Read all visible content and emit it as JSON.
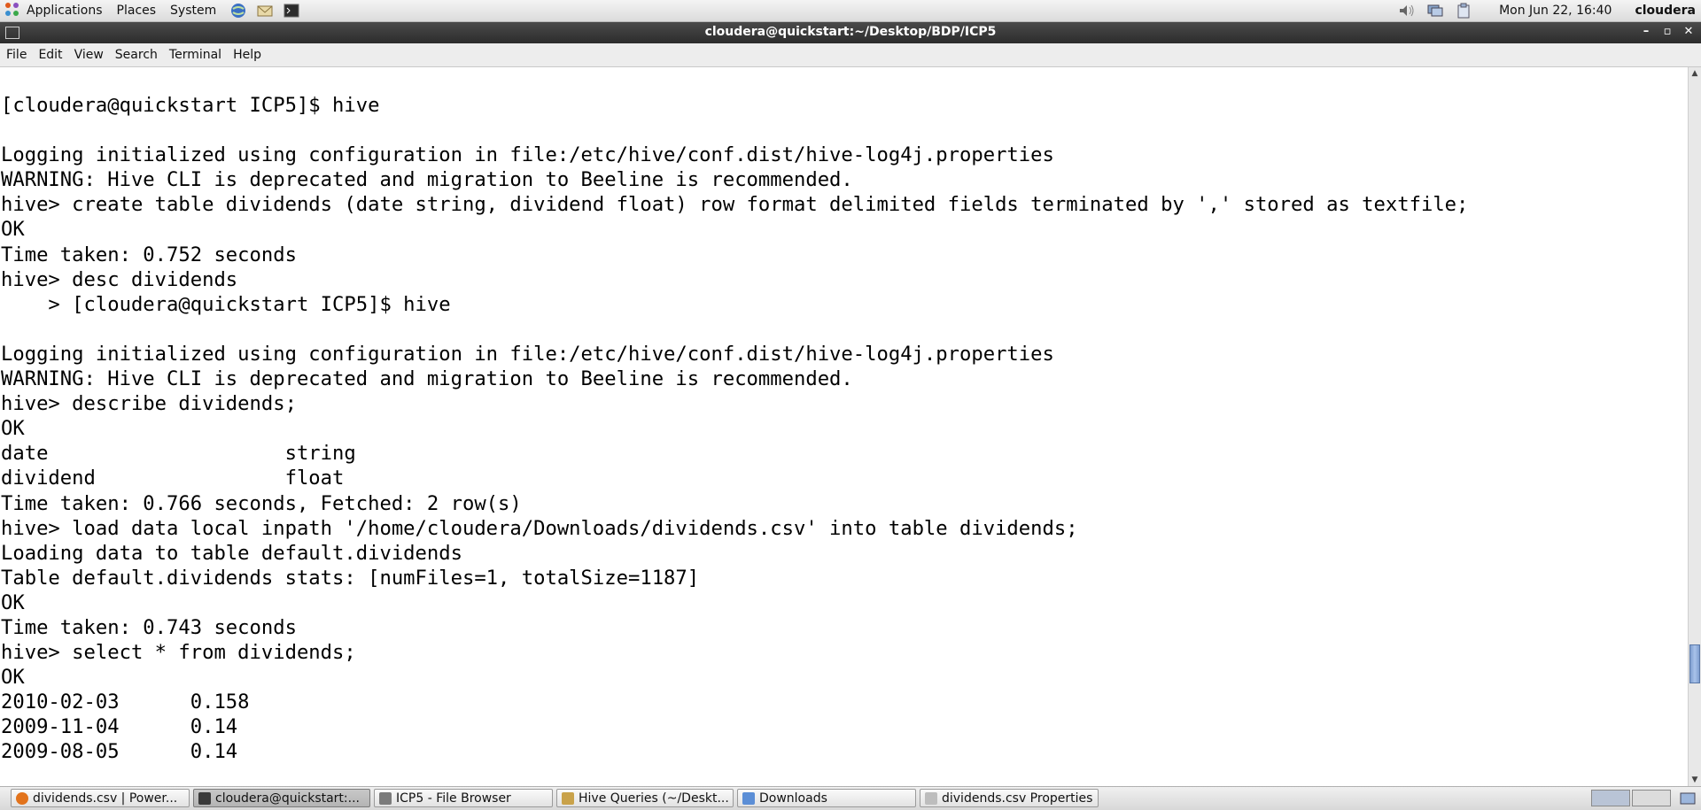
{
  "top_panel": {
    "menus": [
      "Applications",
      "Places",
      "System"
    ],
    "datetime": "Mon Jun 22, 16:40",
    "user": "cloudera"
  },
  "window": {
    "title": "cloudera@quickstart:~/Desktop/BDP/ICP5",
    "controls": [
      "–",
      "▫",
      "✕"
    ]
  },
  "menubar": [
    "File",
    "Edit",
    "View",
    "Search",
    "Terminal",
    "Help"
  ],
  "terminal": {
    "lines": [
      "[cloudera@quickstart ICP5]$ hive",
      "",
      "Logging initialized using configuration in file:/etc/hive/conf.dist/hive-log4j.properties",
      "WARNING: Hive CLI is deprecated and migration to Beeline is recommended.",
      "hive> create table dividends (date string, dividend float) row format delimited fields terminated by ',' stored as textfile;",
      "OK",
      "Time taken: 0.752 seconds",
      "hive> desc dividends",
      "    > [cloudera@quickstart ICP5]$ hive",
      "",
      "Logging initialized using configuration in file:/etc/hive/conf.dist/hive-log4j.properties",
      "WARNING: Hive CLI is deprecated and migration to Beeline is recommended.",
      "hive> describe dividends;",
      "OK",
      "date                    string",
      "dividend                float",
      "Time taken: 0.766 seconds, Fetched: 2 row(s)",
      "hive> load data local inpath '/home/cloudera/Downloads/dividends.csv' into table dividends;",
      "Loading data to table default.dividends",
      "Table default.dividends stats: [numFiles=1, totalSize=1187]",
      "OK",
      "Time taken: 0.743 seconds",
      "hive> select * from dividends;",
      "OK",
      "2010-02-03      0.158",
      "2009-11-04      0.14",
      "2009-08-05      0.14"
    ]
  },
  "taskbar": {
    "tasks": [
      {
        "label": "dividends.csv | Power...",
        "icon": "firefox-icon",
        "color": "#e2731c",
        "active": false
      },
      {
        "label": "cloudera@quickstart:...",
        "icon": "terminal-icon",
        "color": "#3a3a3a",
        "active": true
      },
      {
        "label": "ICP5 - File Browser",
        "icon": "file-browser-icon",
        "color": "#7b7b7b",
        "active": false
      },
      {
        "label": "Hive Queries (~/Deskt...",
        "icon": "text-editor-icon",
        "color": "#c9a24a",
        "active": false
      },
      {
        "label": "Downloads",
        "icon": "folder-icon",
        "color": "#5b8ed6",
        "active": false
      },
      {
        "label": "dividends.csv Properties",
        "icon": "document-icon",
        "color": "#bdbdbd",
        "active": false
      }
    ]
  }
}
